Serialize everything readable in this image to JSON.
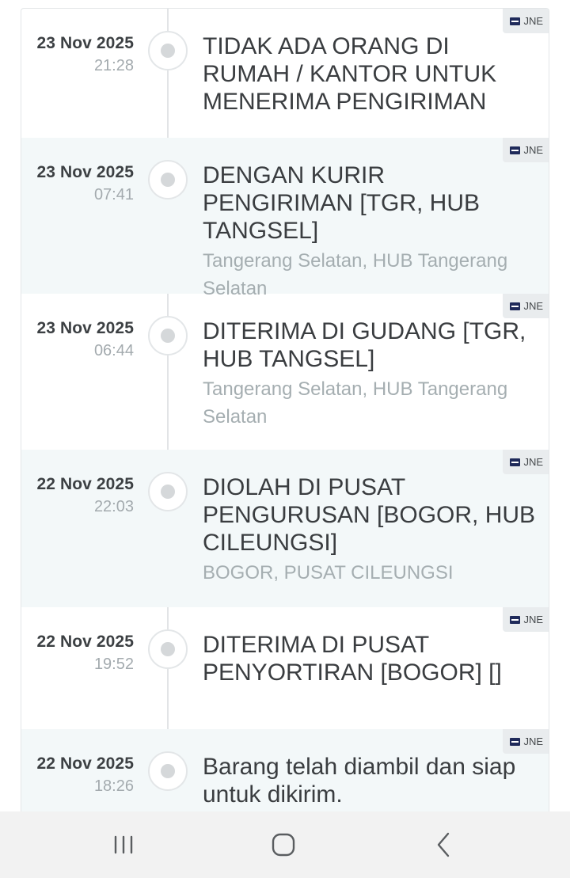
{
  "timeline": [
    {
      "date": "23 Nov 2025",
      "time": "21:28",
      "status": "TIDAK ADA ORANG DI RUMAH / KANTOR UNTUK MENERIMA PENGIRIMAN",
      "location": "",
      "courier": "JNE"
    },
    {
      "date": "23 Nov 2025",
      "time": "07:41",
      "status": "DENGAN KURIR PENGIRIMAN [TGR, HUB TANGSEL]",
      "location": "Tangerang Selatan, HUB Tangerang Selatan",
      "courier": "JNE"
    },
    {
      "date": "23 Nov 2025",
      "time": "06:44",
      "status": "DITERIMA DI GUDANG [TGR, HUB TANGSEL]",
      "location": "Tangerang Selatan, HUB Tangerang Selatan",
      "courier": "JNE"
    },
    {
      "date": "22 Nov 2025",
      "time": "22:03",
      "status": "DIOLAH DI PUSAT PENGURUSAN [BOGOR, HUB CILEUNGSI]",
      "location": "BOGOR, PUSAT CILEUNGSI",
      "courier": "JNE"
    },
    {
      "date": "22 Nov 2025",
      "time": "19:52",
      "status": "DITERIMA DI PUSAT PENYORTIRAN [BOGOR] []",
      "location": "",
      "courier": "JNE"
    },
    {
      "date": "22 Nov 2025",
      "time": "18:26",
      "status": "Barang telah diambil dan siap untuk dikirim.",
      "location": "",
      "courier": "JNE"
    }
  ],
  "navbar": {
    "recent_icon": "recent-apps-icon",
    "home_icon": "home-icon",
    "back_icon": "back-icon"
  },
  "colors": {
    "alt_row": "#f3f8f9",
    "courier_logo": "#1f2a5a"
  }
}
